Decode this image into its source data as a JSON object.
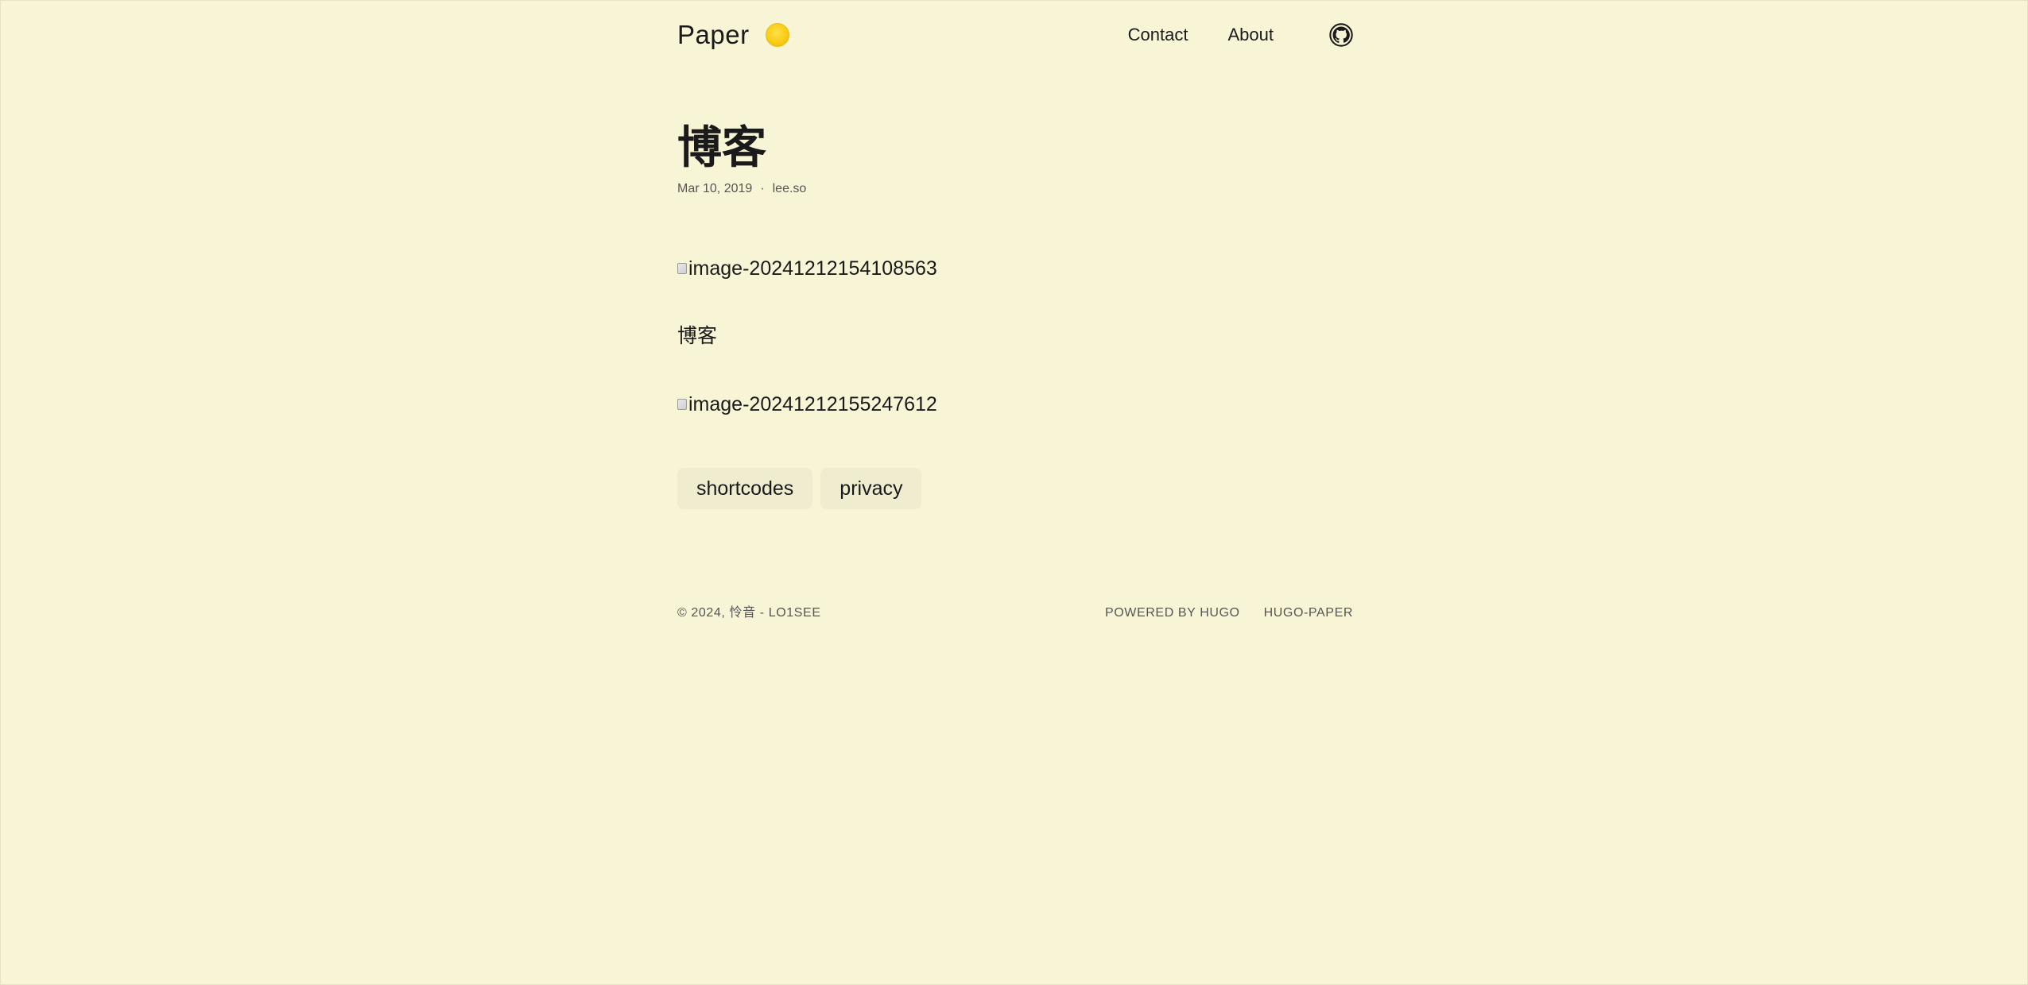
{
  "header": {
    "brand_title": "Paper",
    "theme_toggle_icon": "sun-icon",
    "nav": {
      "contact": "Contact",
      "about": "About"
    },
    "github_icon": "github-icon"
  },
  "post": {
    "title": "博客",
    "date": "Mar 10, 2019",
    "meta_separator": "·",
    "author": "lee.so",
    "image1_alt": "image-20241212154108563",
    "paragraph": "博客",
    "image2_alt": "image-20241212155247612",
    "tags": [
      "shortcodes",
      "privacy"
    ]
  },
  "footer": {
    "copyright": "© 2024, 怜音 - LO1SEE",
    "powered_by": "POWERED BY HUGO",
    "theme_link": "HUGO-PAPER"
  },
  "colors": {
    "background": "#f8f5d7",
    "text": "#1a1a1a",
    "muted": "#555555",
    "tag_background": "#efecd0",
    "toggle": "#facc15"
  }
}
